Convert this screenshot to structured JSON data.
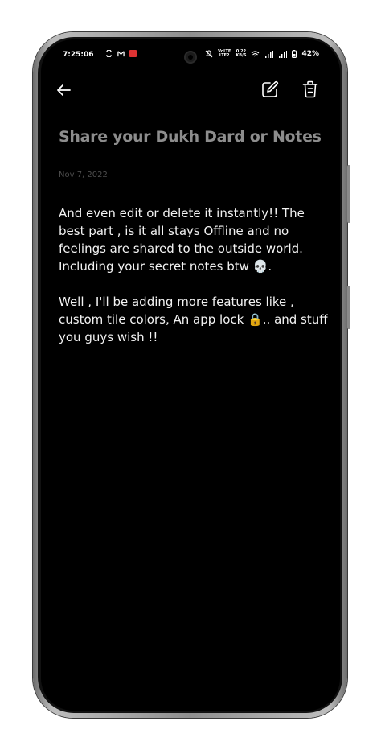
{
  "status_bar": {
    "time": "7:25:06",
    "network_speed_top": "0.22",
    "network_speed_bottom": "KB/S",
    "volte_top": "VoLTE",
    "volte_bottom": "LTE2",
    "battery_percent": "42%"
  },
  "toolbar": {
    "back_icon": "arrow-left-icon",
    "edit_icon": "pencil-edit-icon",
    "delete_icon": "trash-icon"
  },
  "note": {
    "title": "Share your Dukh Dard or Notes",
    "date": "Nov 7, 2022",
    "paragraph_1": "And even edit or delete it instantly!! The best part , is it all stays Offline and no feelings are shared to the outside world. Including your secret notes btw 💀.",
    "paragraph_2": "Well , I'll be adding more features like , custom tile colors, An app lock 🔒.. and stuff you guys wish !!"
  },
  "colors": {
    "screen_background": "#000000",
    "title_color": "#8d8d8d",
    "date_color": "#4e4e4e",
    "body_text_color": "#f2f2f2"
  }
}
